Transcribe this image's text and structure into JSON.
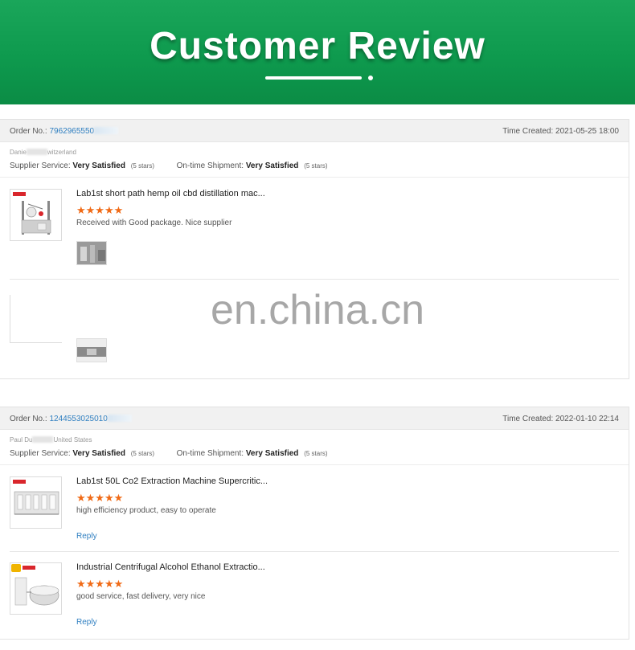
{
  "banner": {
    "title": "Customer Review"
  },
  "watermark": "en.china.cn",
  "labels": {
    "order_no": "Order No.:",
    "time_created": "Time Created:",
    "supplier_service": "Supplier Service:",
    "ontime_shipment": "On-time Shipment:",
    "reply": "Reply"
  },
  "orders": [
    {
      "order_no": "7962965550",
      "time_created": "2021-05-25 18:00",
      "buyer_prefix": "Danie",
      "buyer_suffix": "witzerland",
      "supplier_service": "Very Satisfied",
      "supplier_stars": "(5 stars)",
      "shipment": "Very Satisfied",
      "shipment_stars": "(5 stars)",
      "reviews": [
        {
          "product": "Lab1st short path hemp oil cbd distillation mac...",
          "rating": 5,
          "stars": "★★★★★",
          "comment": "Received with Good package. Nice supplier"
        }
      ]
    },
    {
      "order_no": "1244553025010",
      "time_created": "2022-01-10 22:14",
      "buyer_prefix": "Paul Du",
      "buyer_suffix": "United States",
      "supplier_service": "Very Satisfied",
      "supplier_stars": "(5 stars)",
      "shipment": "Very Satisfied",
      "shipment_stars": "(5 stars)",
      "reviews": [
        {
          "product": "Lab1st 50L Co2 Extraction Machine Supercritic...",
          "rating": 5,
          "stars": "★★★★★",
          "comment": "high efficiency product, easy to operate"
        },
        {
          "product": "Industrial Centrifugal Alcohol Ethanol Extractio...",
          "rating": 5,
          "stars": "★★★★★",
          "comment": "good service, fast delivery, very nice"
        }
      ]
    }
  ],
  "colors": {
    "banner_green": "#0e9a4e",
    "link_blue": "#2f7fc1",
    "star_orange": "#f06a16"
  }
}
